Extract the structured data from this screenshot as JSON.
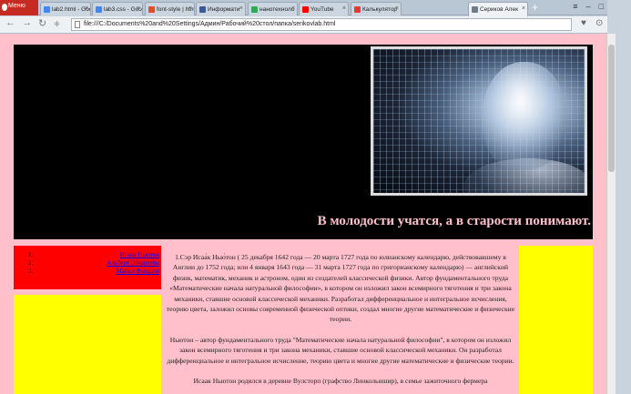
{
  "browser": {
    "menu_label": "Меню",
    "tabs": [
      {
        "label": "lab2.html - Goo",
        "color": "#4285f4"
      },
      {
        "label": "lab3.css - Goo",
        "color": "#4285f4"
      },
      {
        "label": "font-style | htm",
        "color": "#e44d26"
      },
      {
        "label": "Информати",
        "color": "#3b5998"
      },
      {
        "label": "нанотехноло",
        "color": "#34a853"
      },
      {
        "label": "YouTube",
        "color": "#ff0000"
      },
      {
        "label": "Калькулятор",
        "color": "#e53935"
      },
      {
        "label": "Сериков Алек",
        "color": "#6d7b8a"
      }
    ],
    "url": "file:///C:/Documents%20and%20Settings/Админ/Рабочий%20стол/папка/serikovlab.html"
  },
  "page": {
    "motto": "В молодости учатся, а в старости понимают.",
    "menu": [
      {
        "num": "1.",
        "label": "Исаак Ньютон"
      },
      {
        "num": "2.",
        "label": "Альберт Эйнштейн"
      },
      {
        "num": "3.",
        "label": "Майкл Фарадей"
      }
    ],
    "paragraphs": [
      "1.Сэр Исаа́к Нью́тон ( 25 декабря 1642 года — 20 марта 1727 года по юлианскому календарю, действовавшему в Англии до 1752 года; или 4 января 1643 года — 31 марта 1727 года по григорианскому календарю) — английский физик, математик, механик и астроном, один из создателей классической физики. Автор фундаментального труда «Математические начала натуральной философии», в котором он изложил закон всемирного тяготения и три закона механики, ставшие основой классической механики. Разработал дифференциальное и интегральное исчисления, теорию цвета, заложил основы современной физической оптики, создал многие другие математические и физические теории.",
      "Ньютон – автор фундаментального труда \"Математические начала натуральной философии\", в котором он изложил закон всемирного тяготения и три закона механики, ставшие основой классической механики. Он разработал дифференциальное и интегральное исчисление, теорию цвета и многие другие математические и физические теории.",
      "Исаак Ньютон родился в деревне Вулсторп (графство Линкольншир), в семье зажиточного фермера"
    ]
  }
}
